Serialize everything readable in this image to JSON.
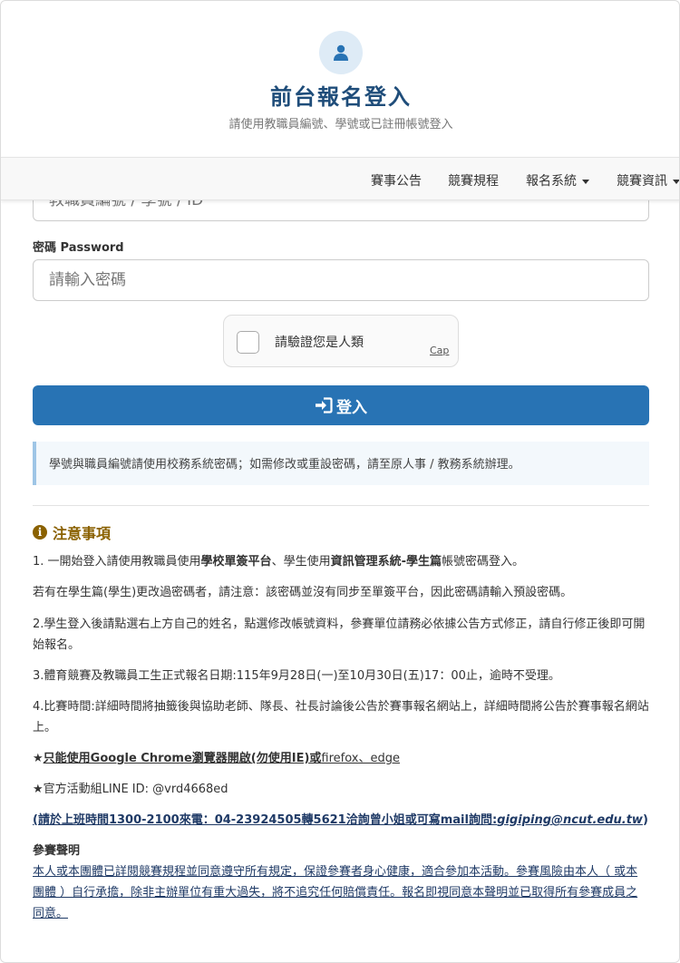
{
  "header": {
    "title": "前台報名登入",
    "subtitle": "請使用教職員編號、學號或已註冊帳號登入"
  },
  "nav": {
    "items": [
      "賽事公告",
      "競賽規程",
      "報名系統",
      "競賽資訊"
    ]
  },
  "form": {
    "account_placeholder": "教職員編號 / 學號 / ID",
    "password_label": "密碼 Password",
    "password_placeholder": "請輸入密碼",
    "captcha_text": "請驗證您是人類",
    "captcha_brand": "Cap",
    "login_label": "登入"
  },
  "info_text": "學號與職員編號請使用校務系統密碼；如需修改或重設密碼，請至原人事 / 教務系統辦理。",
  "notice": {
    "heading": "注意事項",
    "item1_a": "1. 一開始登入請使用教職員使用",
    "item1_b": "學校單簽平台",
    "item1_c": "、學生使用",
    "item1_d": "資訊管理系統-學生篇",
    "item1_e": "帳號密碼登入。",
    "item1_note": "若有在學生篇(學生)更改過密碼者，請注意：該密碼並沒有同步至單簽平台，因此密碼請輸入預設密碼。",
    "item2": "2.學生登入後請點選右上方自己的姓名，點選修改帳號資料，參賽單位請務必依據公告方式修正，請自行修正後即可開始報名。",
    "item3": "3.體育競賽及教職員工生正式報名日期:115年9月28日(一)至10月30日(五)17：00止，逾時不受理。",
    "item4": "4.比賽時間:詳細時間將抽籤後與協助老師、隊長、社長討論後公告於賽事報名網站上，詳細時間將公告於賽事報名網站上。",
    "browser_a": "★",
    "browser_b": "只能使用Google Chrome瀏覽器開啟(勿使用IE)或",
    "browser_c": "firefox、edge",
    "line": "★官方活動組LINE ID: @vrd4668ed",
    "contact_a": "(請於上班時間1300-2100來電：04-23924505轉5621洽詢曾小姐或可寫mail詢問:",
    "contact_b": "gigiping@ncut.edu.tw",
    "contact_c": ")",
    "disclaimer_title": "參賽聲明",
    "disclaimer": "本人或本團體已詳閱競賽規程並同意遵守所有規定，保證參賽者身心健康，適合參加本活動。參賽風險由本人（ 或本團體 ）自行承擔，除非主辦單位有重大過失，將不追究任何賠償責任。報名即視同意本聲明並已取得所有參賽成員之同意。"
  },
  "colors": {
    "primary": "#2873b4",
    "title": "#1f4d7a",
    "notice": "#8a6100",
    "info_bg": "#f3f8fc"
  }
}
